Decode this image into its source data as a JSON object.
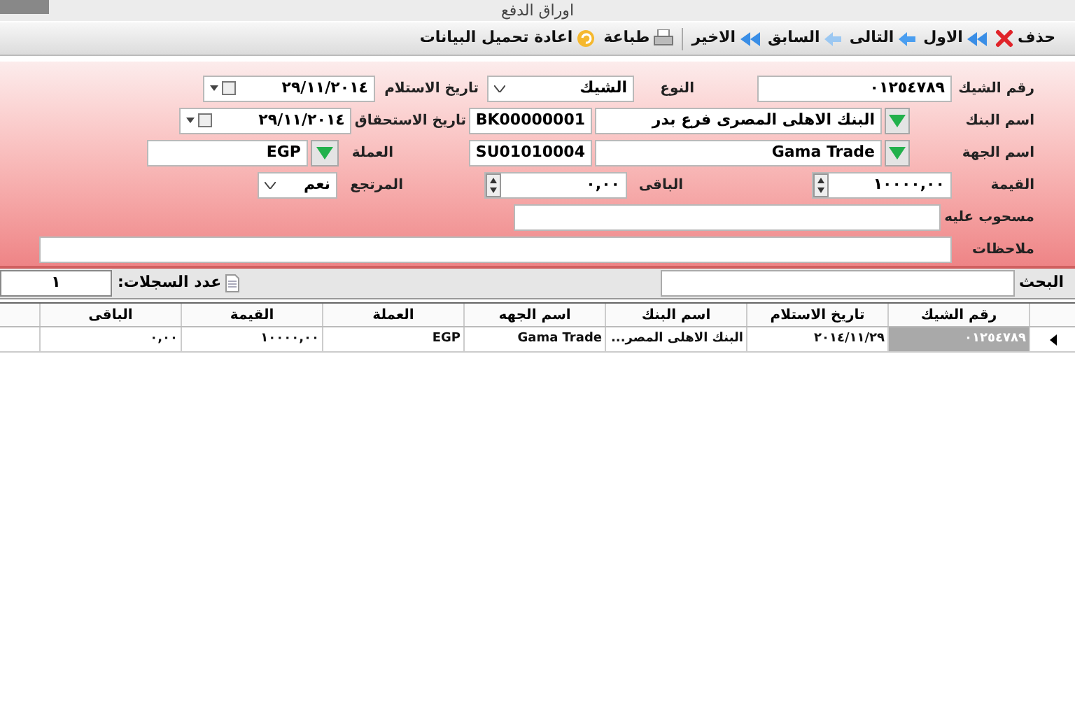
{
  "window": {
    "title": "اوراق الدفع"
  },
  "toolbar": {
    "buttons": [
      {
        "label": "حذف",
        "kind": "delete"
      },
      {
        "label": "الاول",
        "kind": "first"
      },
      {
        "label": "التالى",
        "kind": "next"
      },
      {
        "label": "السابق",
        "kind": "prev"
      },
      {
        "label": "الاخير",
        "kind": "last"
      },
      {
        "label": "طباعة",
        "kind": "print"
      },
      {
        "label": "اعادة تحميل البيانات",
        "kind": "reload"
      }
    ]
  },
  "form": {
    "rows": [
      [
        {
          "kind": "label",
          "text": "رقم الشيك"
        },
        {
          "kind": "text",
          "value": "٠١٢٥٤٧٨٩"
        },
        {
          "kind": "label",
          "text": "النوع"
        },
        {
          "kind": "select",
          "value": "الشيك"
        },
        {
          "kind": "label",
          "text": "تاريخ الاستلام"
        },
        {
          "kind": "date",
          "value": "٢٩/١١/٢٠١٤"
        }
      ],
      [
        {
          "kind": "label",
          "text": "اسم البنك"
        },
        {
          "kind": "lookup"
        },
        {
          "kind": "text",
          "value": "البنك الاهلى المصرى فرع بدر"
        },
        {
          "kind": "text",
          "value": "BK00000001"
        },
        {
          "kind": "label",
          "text": "تاريخ الاستحقاق"
        },
        {
          "kind": "date",
          "value": "٢٩/١١/٢٠١٤"
        }
      ],
      [
        {
          "kind": "label",
          "text": "اسم الجهة"
        },
        {
          "kind": "lookup"
        },
        {
          "kind": "text",
          "value": "Gama Trade"
        },
        {
          "kind": "text",
          "value": "SU01010004"
        },
        {
          "kind": "label",
          "text": "العملة"
        },
        {
          "kind": "lookup"
        },
        {
          "kind": "text",
          "value": "EGP"
        }
      ],
      [
        {
          "kind": "label",
          "text": "القيمة"
        },
        {
          "kind": "spin",
          "value": "١٠٠٠٠,٠٠"
        },
        {
          "kind": "label",
          "text": "الباقى"
        },
        {
          "kind": "spin",
          "value": "٠,٠٠"
        },
        {
          "kind": "label",
          "text": "المرتجع"
        },
        {
          "kind": "select",
          "value": "نعم"
        }
      ],
      [
        {
          "kind": "label",
          "text": "مسحوب عليه"
        },
        {
          "kind": "text"
        }
      ],
      [
        {
          "kind": "label",
          "text": "ملاحظات"
        },
        {
          "kind": "text"
        }
      ]
    ]
  },
  "search": {
    "label": "البحث",
    "records_label": "عدد السجلات:",
    "records_value": "١"
  },
  "table": {
    "columns": [
      "رقم الشيك",
      "تاريخ الاستلام",
      "اسم البنك",
      "اسم الجهه",
      "العملة",
      "القيمة",
      "الباقى"
    ],
    "rows": [
      {
        "selected": true,
        "cells": [
          "٠١٢٥٤٧٨٩",
          "٢٠١٤/١١/٢٩",
          "البنك الاهلى المصر...",
          "Gama Trade",
          "EGP",
          "١٠٠٠٠,٠٠",
          "٠,٠٠"
        ]
      }
    ]
  }
}
